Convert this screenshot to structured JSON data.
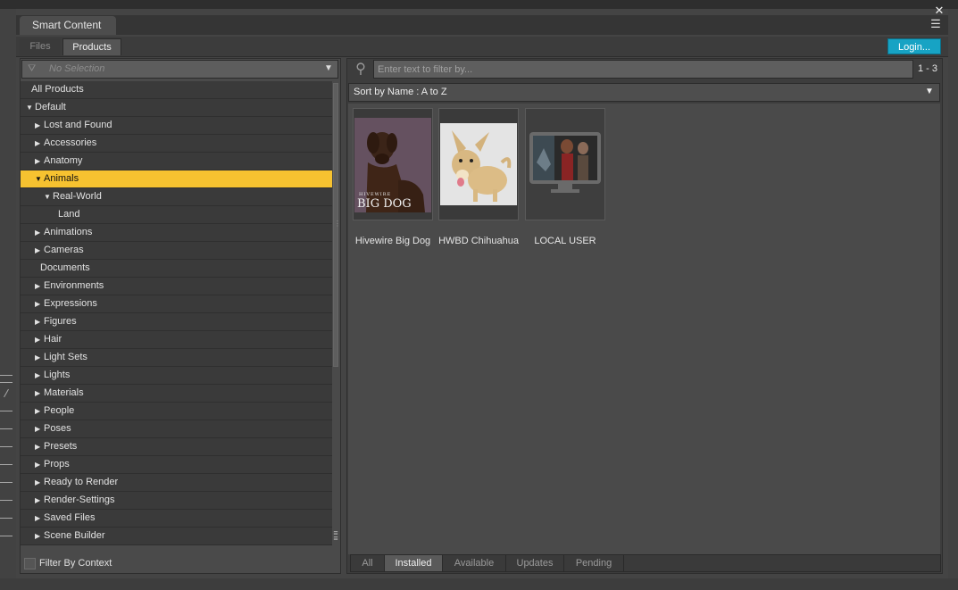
{
  "panel": {
    "title": "Smart Content",
    "menu_icon": "panel-menu-icon",
    "close_icon": "close-icon"
  },
  "subtabs": {
    "files": "Files",
    "products": "Products",
    "login": "Login..."
  },
  "left": {
    "selection_placeholder": "No Selection",
    "filter_by_context": "Filter By Context",
    "tree": [
      {
        "label": "All Products",
        "indent": 0,
        "arrow": "none",
        "selected": false
      },
      {
        "label": "Default",
        "indent": 0,
        "arrow": "down",
        "selected": false
      },
      {
        "label": "Lost and Found",
        "indent": 1,
        "arrow": "right",
        "selected": false
      },
      {
        "label": "Accessories",
        "indent": 1,
        "arrow": "right",
        "selected": false
      },
      {
        "label": "Anatomy",
        "indent": 1,
        "arrow": "right",
        "selected": false
      },
      {
        "label": "Animals",
        "indent": 1,
        "arrow": "down",
        "selected": true
      },
      {
        "label": "Real-World",
        "indent": 2,
        "arrow": "down",
        "selected": false
      },
      {
        "label": "Land",
        "indent": 3,
        "arrow": "none",
        "selected": false
      },
      {
        "label": "Animations",
        "indent": 1,
        "arrow": "right",
        "selected": false
      },
      {
        "label": "Cameras",
        "indent": 1,
        "arrow": "right",
        "selected": false
      },
      {
        "label": "Documents",
        "indent": 1,
        "arrow": "none",
        "selected": false
      },
      {
        "label": "Environments",
        "indent": 1,
        "arrow": "right",
        "selected": false
      },
      {
        "label": "Expressions",
        "indent": 1,
        "arrow": "right",
        "selected": false
      },
      {
        "label": "Figures",
        "indent": 1,
        "arrow": "right",
        "selected": false
      },
      {
        "label": "Hair",
        "indent": 1,
        "arrow": "right",
        "selected": false
      },
      {
        "label": "Light Sets",
        "indent": 1,
        "arrow": "right",
        "selected": false
      },
      {
        "label": "Lights",
        "indent": 1,
        "arrow": "right",
        "selected": false
      },
      {
        "label": "Materials",
        "indent": 1,
        "arrow": "right",
        "selected": false
      },
      {
        "label": "People",
        "indent": 1,
        "arrow": "right",
        "selected": false
      },
      {
        "label": "Poses",
        "indent": 1,
        "arrow": "right",
        "selected": false
      },
      {
        "label": "Presets",
        "indent": 1,
        "arrow": "right",
        "selected": false
      },
      {
        "label": "Props",
        "indent": 1,
        "arrow": "right",
        "selected": false
      },
      {
        "label": "Ready to Render",
        "indent": 1,
        "arrow": "right",
        "selected": false
      },
      {
        "label": "Render-Settings",
        "indent": 1,
        "arrow": "right",
        "selected": false
      },
      {
        "label": "Saved Files",
        "indent": 1,
        "arrow": "right",
        "selected": false
      },
      {
        "label": "Scene Builder",
        "indent": 1,
        "arrow": "right",
        "selected": false
      }
    ]
  },
  "right": {
    "search_placeholder": "Enter text to filter by...",
    "result_count": "1 - 3",
    "sort_label": "Sort by Name : A to Z",
    "products": [
      {
        "label": "Hivewire Big Dog",
        "thumb_line1": "HIVEWIRE",
        "thumb_line2": "BIG DOG"
      },
      {
        "label": "HWBD Chihuahua"
      },
      {
        "label": "LOCAL USER"
      }
    ],
    "bottom_tabs": [
      {
        "label": "All",
        "active": false
      },
      {
        "label": "Installed",
        "active": true
      },
      {
        "label": "Available",
        "active": false
      },
      {
        "label": "Updates",
        "active": false
      },
      {
        "label": "Pending",
        "active": false
      }
    ]
  },
  "colors": {
    "selection": "#f6c230",
    "login": "#17a3c4"
  }
}
